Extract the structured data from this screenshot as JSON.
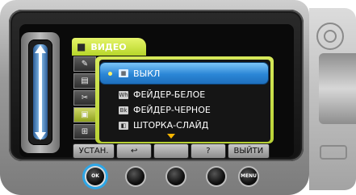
{
  "header": {
    "title": "ВИДЕО",
    "icon": "video-camera-icon"
  },
  "side_tabs": [
    {
      "icon": "camera-settings-icon",
      "glyph": "✎"
    },
    {
      "icon": "playback-settings-icon",
      "glyph": "▤"
    },
    {
      "icon": "wrench-icon",
      "glyph": "✂"
    },
    {
      "icon": "video-effect-icon",
      "glyph": "▣",
      "active": true
    },
    {
      "icon": "media-icon",
      "glyph": "⊞"
    }
  ],
  "menu": {
    "items": [
      {
        "label": "ВЫКЛ",
        "icon_text": "▦",
        "selected": true
      },
      {
        "label": "ФЕЙДЕР-БЕЛОЕ",
        "icon_text": "Wh"
      },
      {
        "label": "ФЕЙДЕР-ЧЕРНОЕ",
        "icon_text": "Bk"
      },
      {
        "label": "ШТОРКА-СЛАЙД",
        "icon_text": "◧"
      }
    ]
  },
  "softkeys": {
    "set": "УСТАН.",
    "back": "↩",
    "blank": "",
    "help": "?",
    "exit": "ВЫЙТИ"
  },
  "hardware_buttons": {
    "ok_label": "OK",
    "menu_label": "MENU"
  },
  "colors": {
    "highlight": "#2b86d6",
    "accent_green": "#b8d135",
    "focus_ring": "#2ea6e6"
  }
}
